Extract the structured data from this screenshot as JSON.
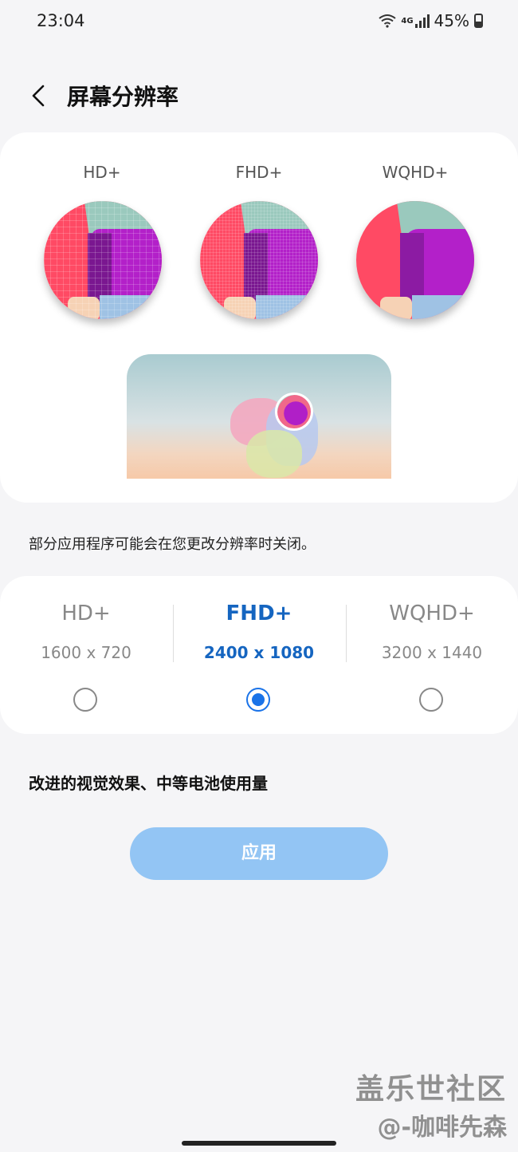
{
  "status_bar": {
    "time": "23:04",
    "battery": "45%",
    "network": "4G"
  },
  "header": {
    "title": "屏幕分辨率"
  },
  "preview": {
    "labels": [
      "HD+",
      "FHD+",
      "WQHD+"
    ]
  },
  "notice": "部分应用程序可能会在您更改分辨率时关闭。",
  "options": [
    {
      "name": "HD+",
      "resolution": "1600 x 720",
      "selected": false
    },
    {
      "name": "FHD+",
      "resolution": "2400 x 1080",
      "selected": true
    },
    {
      "name": "WQHD+",
      "resolution": "3200 x 1440",
      "selected": false
    }
  ],
  "description": "改进的视觉效果、中等电池使用量",
  "apply_button": "应用",
  "watermark": {
    "line1": "盖乐世社区",
    "line2": "@-咖啡先森"
  },
  "colors": {
    "accent": "#1a73e8",
    "selected_text": "#1565c0",
    "apply_bg": "#93c5f4"
  }
}
